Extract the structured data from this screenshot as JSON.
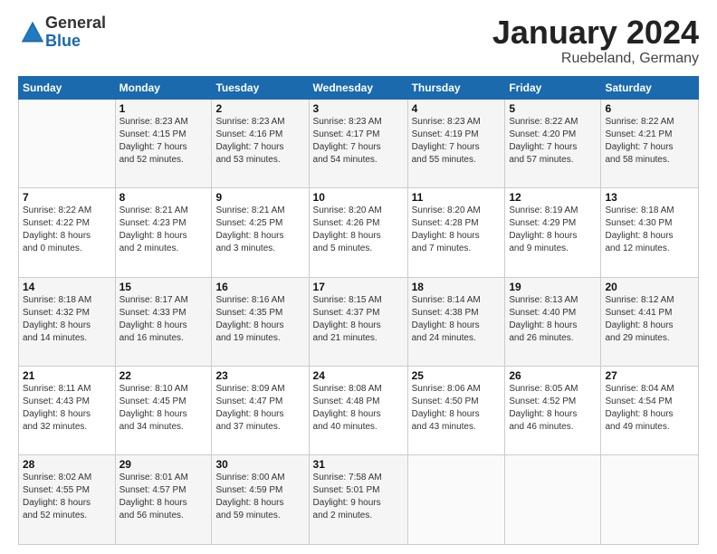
{
  "logo": {
    "general": "General",
    "blue": "Blue"
  },
  "title": {
    "month": "January 2024",
    "location": "Ruebeland, Germany"
  },
  "weekdays": [
    "Sunday",
    "Monday",
    "Tuesday",
    "Wednesday",
    "Thursday",
    "Friday",
    "Saturday"
  ],
  "weeks": [
    [
      {
        "day": "",
        "info": ""
      },
      {
        "day": "1",
        "info": "Sunrise: 8:23 AM\nSunset: 4:15 PM\nDaylight: 7 hours\nand 52 minutes."
      },
      {
        "day": "2",
        "info": "Sunrise: 8:23 AM\nSunset: 4:16 PM\nDaylight: 7 hours\nand 53 minutes."
      },
      {
        "day": "3",
        "info": "Sunrise: 8:23 AM\nSunset: 4:17 PM\nDaylight: 7 hours\nand 54 minutes."
      },
      {
        "day": "4",
        "info": "Sunrise: 8:23 AM\nSunset: 4:19 PM\nDaylight: 7 hours\nand 55 minutes."
      },
      {
        "day": "5",
        "info": "Sunrise: 8:22 AM\nSunset: 4:20 PM\nDaylight: 7 hours\nand 57 minutes."
      },
      {
        "day": "6",
        "info": "Sunrise: 8:22 AM\nSunset: 4:21 PM\nDaylight: 7 hours\nand 58 minutes."
      }
    ],
    [
      {
        "day": "7",
        "info": "Sunrise: 8:22 AM\nSunset: 4:22 PM\nDaylight: 8 hours\nand 0 minutes."
      },
      {
        "day": "8",
        "info": "Sunrise: 8:21 AM\nSunset: 4:23 PM\nDaylight: 8 hours\nand 2 minutes."
      },
      {
        "day": "9",
        "info": "Sunrise: 8:21 AM\nSunset: 4:25 PM\nDaylight: 8 hours\nand 3 minutes."
      },
      {
        "day": "10",
        "info": "Sunrise: 8:20 AM\nSunset: 4:26 PM\nDaylight: 8 hours\nand 5 minutes."
      },
      {
        "day": "11",
        "info": "Sunrise: 8:20 AM\nSunset: 4:28 PM\nDaylight: 8 hours\nand 7 minutes."
      },
      {
        "day": "12",
        "info": "Sunrise: 8:19 AM\nSunset: 4:29 PM\nDaylight: 8 hours\nand 9 minutes."
      },
      {
        "day": "13",
        "info": "Sunrise: 8:18 AM\nSunset: 4:30 PM\nDaylight: 8 hours\nand 12 minutes."
      }
    ],
    [
      {
        "day": "14",
        "info": "Sunrise: 8:18 AM\nSunset: 4:32 PM\nDaylight: 8 hours\nand 14 minutes."
      },
      {
        "day": "15",
        "info": "Sunrise: 8:17 AM\nSunset: 4:33 PM\nDaylight: 8 hours\nand 16 minutes."
      },
      {
        "day": "16",
        "info": "Sunrise: 8:16 AM\nSunset: 4:35 PM\nDaylight: 8 hours\nand 19 minutes."
      },
      {
        "day": "17",
        "info": "Sunrise: 8:15 AM\nSunset: 4:37 PM\nDaylight: 8 hours\nand 21 minutes."
      },
      {
        "day": "18",
        "info": "Sunrise: 8:14 AM\nSunset: 4:38 PM\nDaylight: 8 hours\nand 24 minutes."
      },
      {
        "day": "19",
        "info": "Sunrise: 8:13 AM\nSunset: 4:40 PM\nDaylight: 8 hours\nand 26 minutes."
      },
      {
        "day": "20",
        "info": "Sunrise: 8:12 AM\nSunset: 4:41 PM\nDaylight: 8 hours\nand 29 minutes."
      }
    ],
    [
      {
        "day": "21",
        "info": "Sunrise: 8:11 AM\nSunset: 4:43 PM\nDaylight: 8 hours\nand 32 minutes."
      },
      {
        "day": "22",
        "info": "Sunrise: 8:10 AM\nSunset: 4:45 PM\nDaylight: 8 hours\nand 34 minutes."
      },
      {
        "day": "23",
        "info": "Sunrise: 8:09 AM\nSunset: 4:47 PM\nDaylight: 8 hours\nand 37 minutes."
      },
      {
        "day": "24",
        "info": "Sunrise: 8:08 AM\nSunset: 4:48 PM\nDaylight: 8 hours\nand 40 minutes."
      },
      {
        "day": "25",
        "info": "Sunrise: 8:06 AM\nSunset: 4:50 PM\nDaylight: 8 hours\nand 43 minutes."
      },
      {
        "day": "26",
        "info": "Sunrise: 8:05 AM\nSunset: 4:52 PM\nDaylight: 8 hours\nand 46 minutes."
      },
      {
        "day": "27",
        "info": "Sunrise: 8:04 AM\nSunset: 4:54 PM\nDaylight: 8 hours\nand 49 minutes."
      }
    ],
    [
      {
        "day": "28",
        "info": "Sunrise: 8:02 AM\nSunset: 4:55 PM\nDaylight: 8 hours\nand 52 minutes."
      },
      {
        "day": "29",
        "info": "Sunrise: 8:01 AM\nSunset: 4:57 PM\nDaylight: 8 hours\nand 56 minutes."
      },
      {
        "day": "30",
        "info": "Sunrise: 8:00 AM\nSunset: 4:59 PM\nDaylight: 8 hours\nand 59 minutes."
      },
      {
        "day": "31",
        "info": "Sunrise: 7:58 AM\nSunset: 5:01 PM\nDaylight: 9 hours\nand 2 minutes."
      },
      {
        "day": "",
        "info": ""
      },
      {
        "day": "",
        "info": ""
      },
      {
        "day": "",
        "info": ""
      }
    ]
  ]
}
